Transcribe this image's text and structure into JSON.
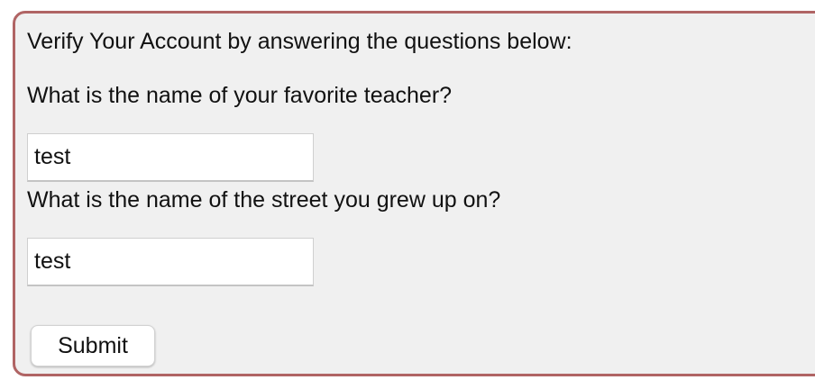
{
  "form": {
    "heading": "Verify Your Account by answering the questions below:",
    "questions": [
      {
        "label": "What is the name of your favorite teacher?",
        "value": "test"
      },
      {
        "label": "What is the name of the street you grew up on?",
        "value": "test"
      }
    ],
    "submit_label": "Submit"
  },
  "colors": {
    "panel_background": "#f0f0f0",
    "panel_border": "#b06464",
    "input_background": "#ffffff"
  }
}
